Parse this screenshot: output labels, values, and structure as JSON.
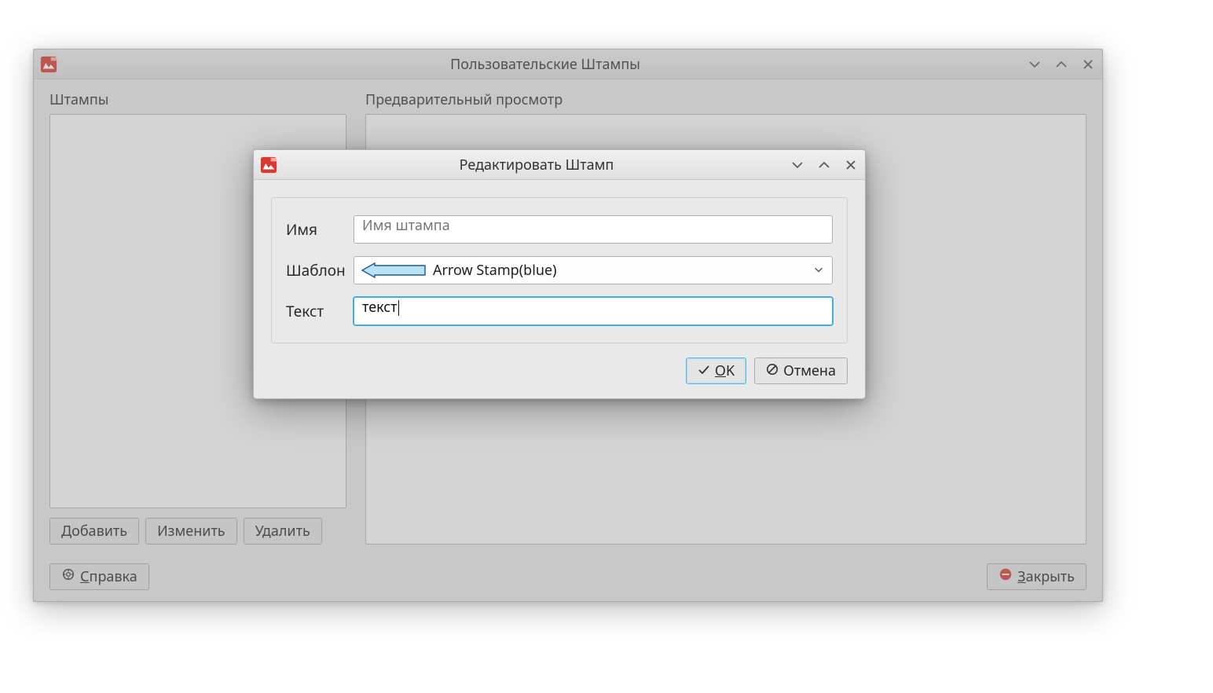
{
  "mainWindow": {
    "title": "Пользовательские Штампы",
    "sections": {
      "stamps_label": "Штампы",
      "preview_label": "Предварительный просмотр"
    },
    "buttons": {
      "add": "Добавить",
      "edit": "Изменить",
      "delete": "Удалить",
      "help_prefix": "С",
      "help_rest": "правка",
      "close_prefix": "З",
      "close_rest": "акрыть"
    }
  },
  "dialog": {
    "title": "Редактировать Штамп",
    "labels": {
      "name": "Имя",
      "template": "Шаблон",
      "text": "Текст"
    },
    "fields": {
      "name_value": "Имя штампа",
      "template_selected": "Arrow Stamp(blue)",
      "text_value": "текст"
    },
    "buttons": {
      "ok_prefix": "O",
      "ok_rest": "K",
      "cancel": "Отмена"
    }
  },
  "colors": {
    "arrow_fill": "#bce2f7",
    "arrow_stroke": "#1a5f8a"
  }
}
